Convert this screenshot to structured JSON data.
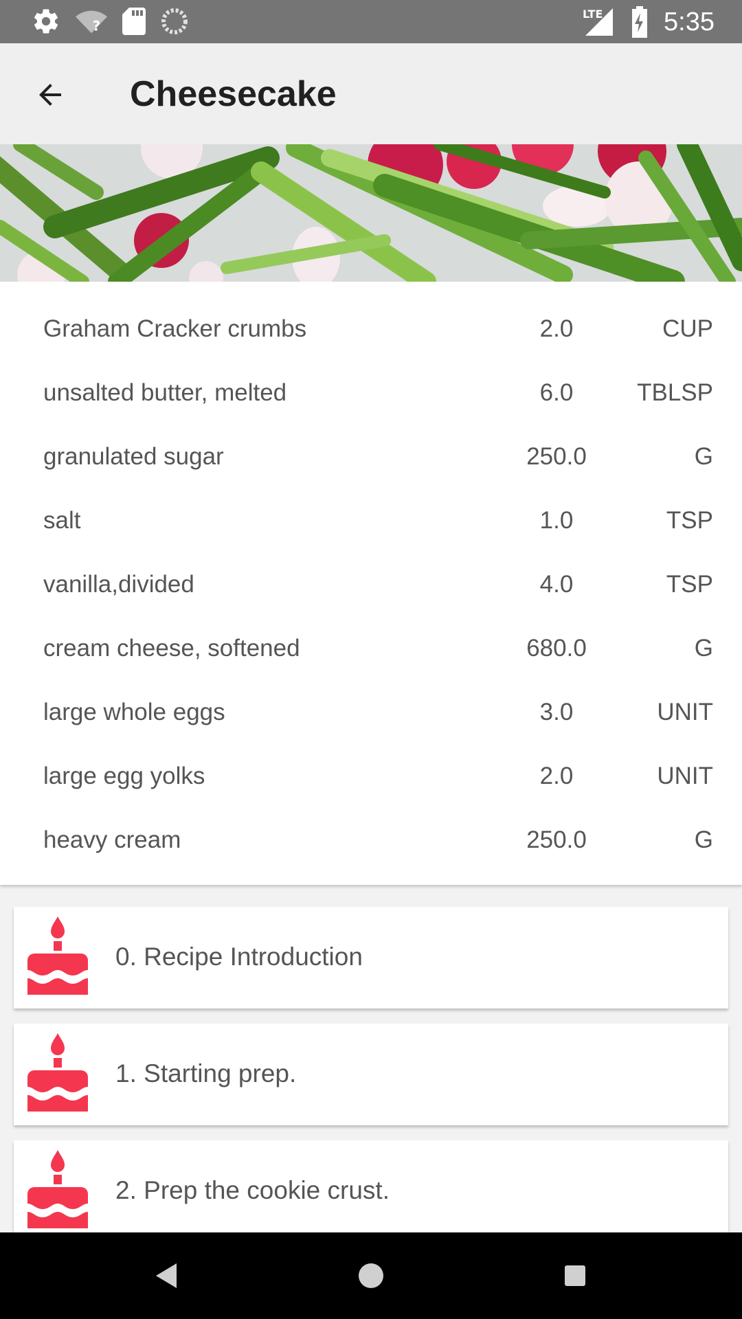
{
  "status_bar": {
    "time": "5:35",
    "network_label": "LTE",
    "icons": [
      "settings-icon",
      "wifi-unknown-icon",
      "sd-card-icon",
      "sync-icon",
      "signal-icon",
      "battery-charging-icon"
    ]
  },
  "app_bar": {
    "title": "Cheesecake",
    "back_icon": "arrow-back-icon"
  },
  "hero": {
    "description_icon": "vegetables-photo"
  },
  "ingredients": [
    {
      "name": "Graham Cracker crumbs",
      "quantity": "2.0",
      "unit": "CUP"
    },
    {
      "name": "unsalted butter, melted",
      "quantity": "6.0",
      "unit": "TBLSP"
    },
    {
      "name": "granulated sugar",
      "quantity": "250.0",
      "unit": "G"
    },
    {
      "name": "salt",
      "quantity": "1.0",
      "unit": "TSP"
    },
    {
      "name": "vanilla,divided",
      "quantity": "4.0",
      "unit": "TSP"
    },
    {
      "name": "cream cheese, softened",
      "quantity": "680.0",
      "unit": "G"
    },
    {
      "name": "large whole eggs",
      "quantity": "3.0",
      "unit": "UNIT"
    },
    {
      "name": "large egg yolks",
      "quantity": "2.0",
      "unit": "UNIT"
    },
    {
      "name": "heavy cream",
      "quantity": "250.0",
      "unit": "G"
    }
  ],
  "steps": [
    {
      "label": "0. Recipe Introduction",
      "icon": "cake-icon"
    },
    {
      "label": "1. Starting prep.",
      "icon": "cake-icon"
    },
    {
      "label": "2. Prep the cookie crust.",
      "icon": "cake-icon"
    }
  ],
  "colors": {
    "accent": "#f4364f",
    "status_bar": "#757575",
    "app_bar": "#efefef",
    "text": "#555555"
  },
  "nav_bar": {
    "icons": [
      "back-triangle-icon",
      "home-circle-icon",
      "recents-square-icon"
    ]
  }
}
